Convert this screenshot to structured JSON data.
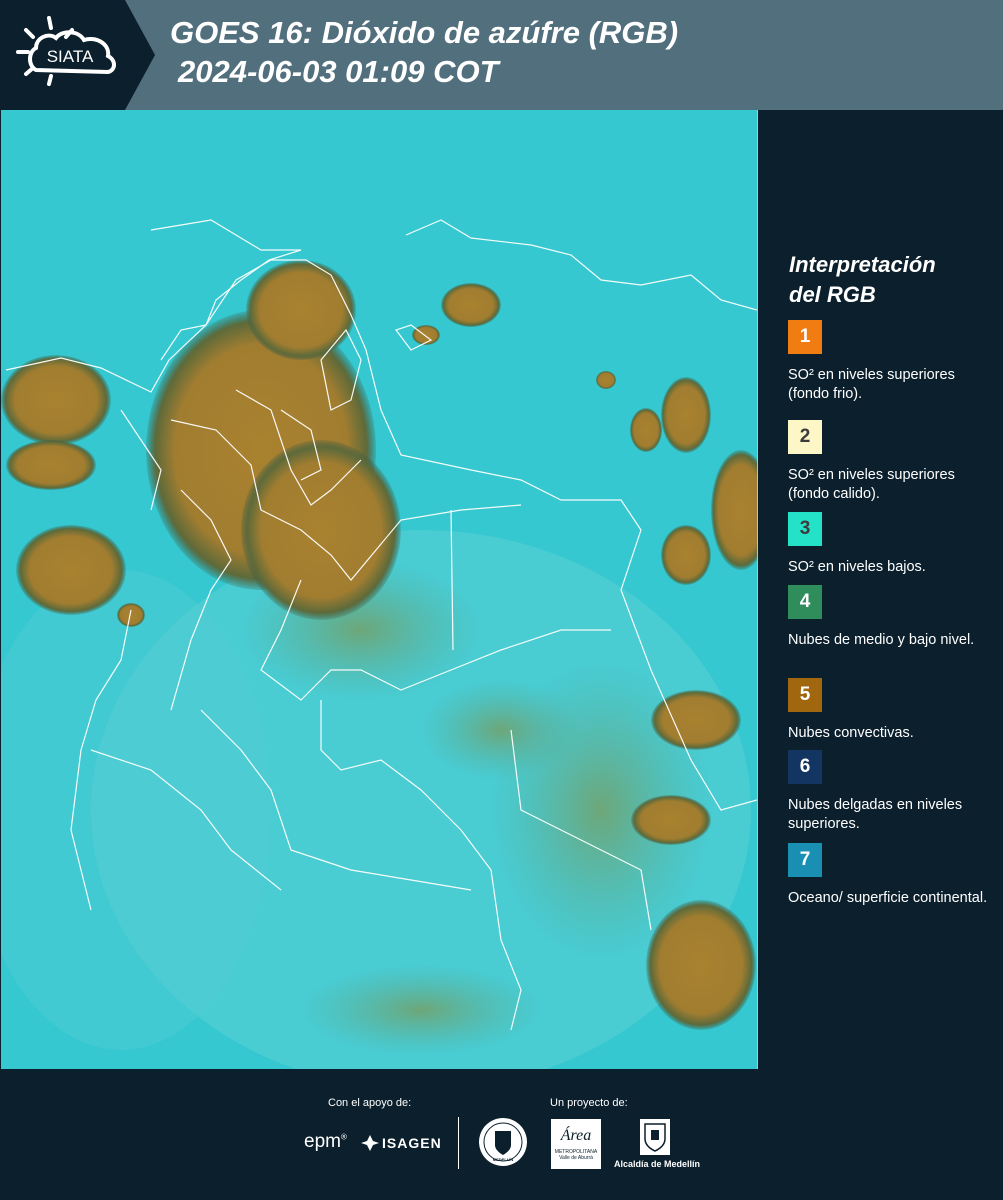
{
  "header": {
    "logo_text": "SIATA",
    "title": "GOES 16: Dióxido de azúfre (RGB)",
    "subtitle": "2024-06-03 01:09 COT"
  },
  "legend": {
    "title_line1": "Interpretación",
    "title_line2": "del RGB",
    "items": [
      {
        "num": "1",
        "color": "#f07c12",
        "text": "SO² en niveles superiores (fondo frio)."
      },
      {
        "num": "2",
        "color": "#fdf6c6",
        "text": "SO² en niveles superiores (fondo calido)."
      },
      {
        "num": "3",
        "color": "#23e2c8",
        "text": "SO² en niveles bajos."
      },
      {
        "num": "4",
        "color": "#2f8d5c",
        "text": "Nubes de medio y bajo nivel."
      },
      {
        "num": "5",
        "color": "#a0670f",
        "text": "Nubes convectivas."
      },
      {
        "num": "6",
        "color": "#123562",
        "text": "Nubes delgadas en niveles superiores."
      },
      {
        "num": "7",
        "color": "#1a8fb4",
        "text": "Oceano/ superficie continental."
      }
    ]
  },
  "footer": {
    "support_label": "Con el apoyo de:",
    "project_label": "Un proyecto de:",
    "sponsor_epm": "epm",
    "sponsor_isagen": "ISAGEN",
    "sponsor_city_seal": "MEDELLÍN",
    "sponsor_area": "Área",
    "sponsor_area_sub1": "METROPOLITANA",
    "sponsor_area_sub2": "Valle de Aburrá",
    "sponsor_alcaldia": "Alcaldía de Medellín"
  },
  "colors": {
    "background": "#0b1f2c",
    "header": "#516f7d",
    "ocean": "#35c8d0",
    "cloud_brown": "#a9822f"
  }
}
